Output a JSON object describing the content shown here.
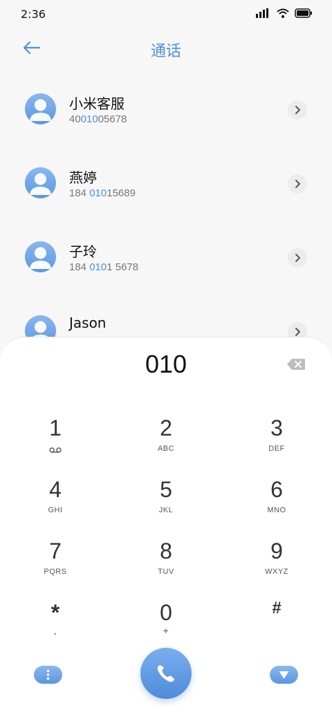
{
  "status_bar": {
    "time": "2:36",
    "icons": [
      "signal-icon",
      "wifi-icon",
      "battery-icon"
    ]
  },
  "header": {
    "title": "通话",
    "back_icon": "arrow-left-icon"
  },
  "colors": {
    "accent": "#4a90e2",
    "background": "#f7f7f7"
  },
  "contacts": [
    {
      "name": "小米客服",
      "number_pre": "40",
      "number_match": "010",
      "number_post": "05678"
    },
    {
      "name": "燕婷",
      "number_pre": "184 ",
      "number_match": "010",
      "number_post": "15689"
    },
    {
      "name": "子玲",
      "number_pre": "184 ",
      "number_match": "010",
      "number_post": "1 5678"
    },
    {
      "name": "Jason",
      "number_pre": "",
      "number_match": "",
      "number_post": ""
    }
  ],
  "dialpad": {
    "input": "010",
    "keys": [
      {
        "digit": "1",
        "letters": ""
      },
      {
        "digit": "2",
        "letters": "ABC"
      },
      {
        "digit": "3",
        "letters": "DEF"
      },
      {
        "digit": "4",
        "letters": "GHI"
      },
      {
        "digit": "5",
        "letters": "JKL"
      },
      {
        "digit": "6",
        "letters": "MNO"
      },
      {
        "digit": "7",
        "letters": "PQRS"
      },
      {
        "digit": "8",
        "letters": "TUV"
      },
      {
        "digit": "9",
        "letters": "WXYZ"
      },
      {
        "digit": "*",
        "letters": ","
      },
      {
        "digit": "0",
        "letters": "+"
      },
      {
        "digit": "#",
        "letters": ""
      }
    ]
  }
}
